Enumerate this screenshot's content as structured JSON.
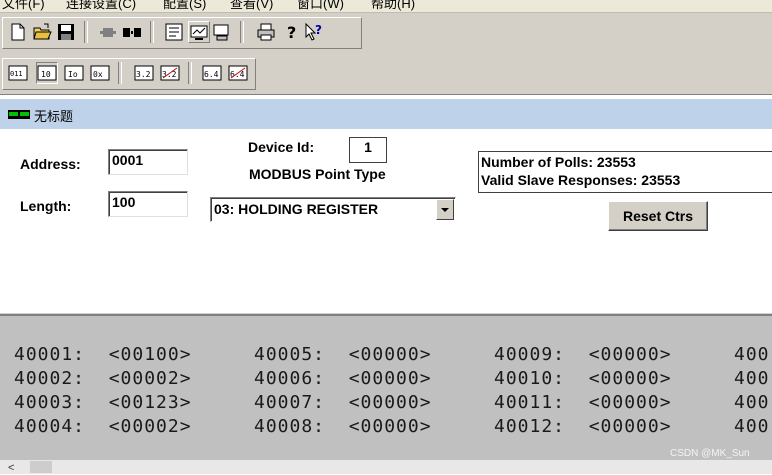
{
  "menu": {
    "items": [
      "文件(F)",
      "连接设置(C)",
      "配置(S)",
      "查看(V)",
      "窗口(W)",
      "帮助(H)"
    ]
  },
  "toolbar": {
    "icons": [
      "new-document-icon",
      "open-folder-icon",
      "save-icon",
      "connect-icon",
      "disconnect-icon",
      "poll-definition-icon",
      "display-icon",
      "communication-icon",
      "print-icon",
      "about-icon",
      "context-help-icon"
    ],
    "format_icons": [
      "format-011-icon",
      "format-10-icon",
      "format-fraction-icon",
      "format-hex-icon",
      "format-3-2-icon",
      "format-3-2-swapped-icon",
      "format-6-4-icon",
      "format-6-4-swapped-icon"
    ],
    "format_labels": [
      "011",
      "10",
      "Io",
      "0x",
      "3.2",
      "3.2",
      "6.4",
      "6.4"
    ]
  },
  "window": {
    "title": "无标题"
  },
  "form": {
    "address_label": "Address:",
    "address_value": "0001",
    "length_label": "Length:",
    "length_value": "100",
    "device_id_label": "Device Id:",
    "device_id_value": "1",
    "point_type_label": "MODBUS Point Type",
    "point_type_value": "03: HOLDING REGISTER"
  },
  "stats": {
    "polls": "Number of Polls: 23553",
    "responses": "Valid Slave Responses: 23553",
    "reset_label": "Reset Ctrs"
  },
  "registers": {
    "rows": [
      [
        "40001:  <00100>",
        "40005:  <00000>",
        "40009:  <00000>",
        "400"
      ],
      [
        "40002:  <00002>",
        "40006:  <00000>",
        "40010:  <00000>",
        "400"
      ],
      [
        "40003:  <00123>",
        "40007:  <00000>",
        "40011:  <00000>",
        "400"
      ],
      [
        "40004:  <00002>",
        "40008:  <00000>",
        "40012:  <00000>",
        "400"
      ]
    ]
  },
  "watermark": "CSDN @MK_Sun",
  "scrollbar": {
    "left_arrow": "<"
  }
}
